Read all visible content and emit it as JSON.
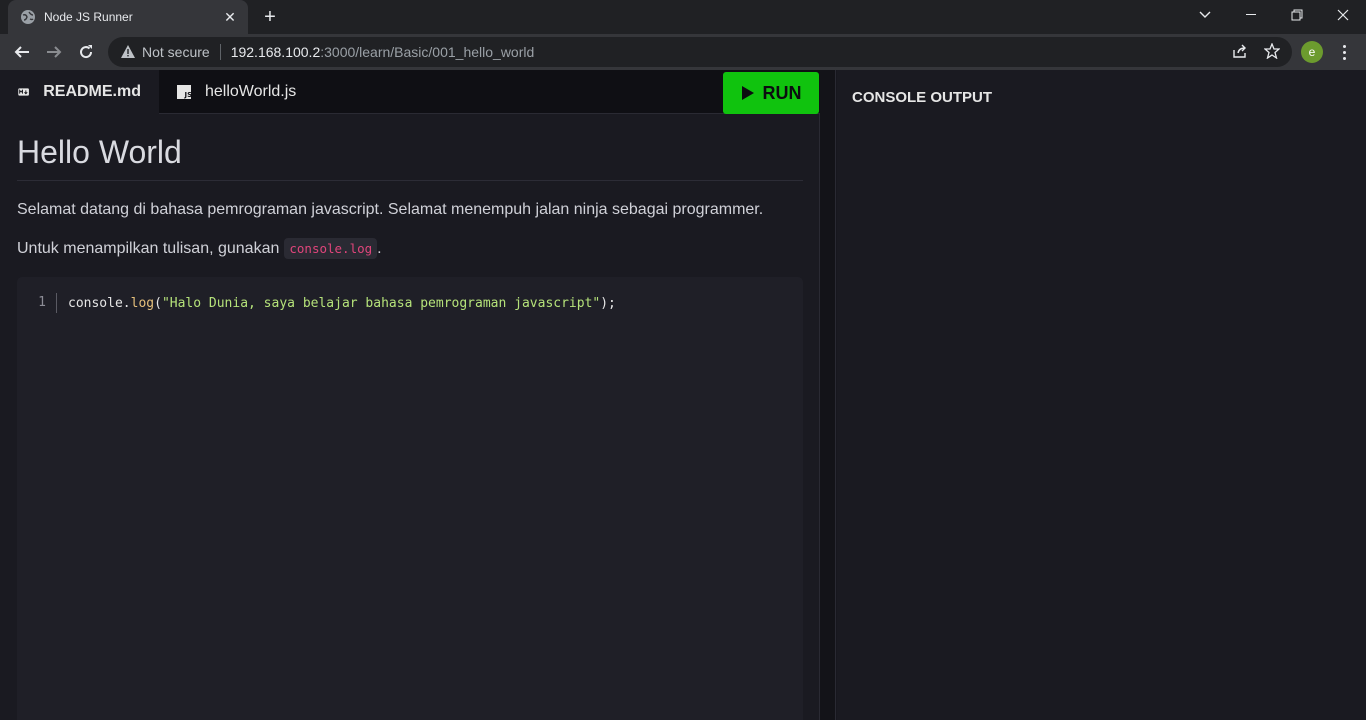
{
  "browser": {
    "tab_title": "Node JS Runner",
    "url_warning": "Not secure",
    "url_host": "192.168.100.2",
    "url_path": ":3000/learn/Basic/001_hello_world",
    "profile_initial": "e"
  },
  "app": {
    "tabs": [
      {
        "label": "README.md",
        "icon": "markdown-icon",
        "active": true
      },
      {
        "label": "helloWorld.js",
        "icon": "js-file-icon",
        "active": false
      }
    ],
    "run_label": "RUN",
    "accent": "#10c30e"
  },
  "readme": {
    "heading": "Hello World",
    "paragraph1": "Selamat datang di bahasa pemrograman javascript. Selamat menempuh jalan ninja sebagai programmer.",
    "paragraph2_text": "Untuk menampilkan tulisan, gunakan",
    "paragraph2_code": "console.log",
    "paragraph2_end": "."
  },
  "editor": {
    "line_number": "1",
    "code_obj": "console.",
    "code_fn": "log",
    "code_open": "(",
    "code_str": "\"Halo Dunia, saya belajar bahasa pemrograman javascript\"",
    "code_close": ");"
  },
  "console": {
    "title": "CONSOLE OUTPUT"
  }
}
